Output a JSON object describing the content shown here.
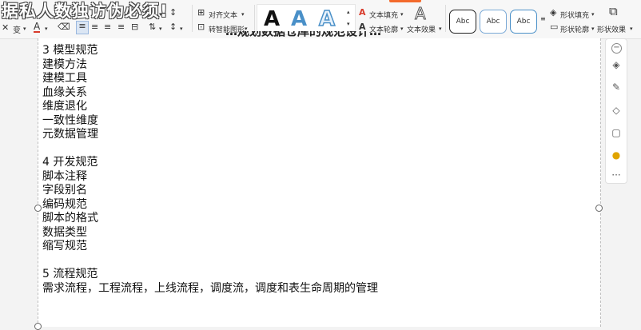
{
  "overlay": {
    "title": "据私人数独访伪必须!"
  },
  "ribbon": {
    "align_text_label": "对齐文本",
    "smart_shape_label": "转智能图形",
    "text_fill_label": "文本填充",
    "text_outline_label": "文本轮廓",
    "text_effect_label": "文本效果",
    "shape_fill_label": "形状填充",
    "shape_outline_label": "形状轮廓",
    "shape_effect_label": "形状效果",
    "font_size_glyph": "变",
    "style_letter": "A",
    "abc_styles": [
      "Abc",
      "Abc",
      "Abc"
    ],
    "colors": {
      "accent": "#f36a2c",
      "text_blue": "#4a90c8",
      "selection_blue": "#2d7ec9"
    }
  },
  "document": {
    "cut_title": "…规划数据仓库的规范设计…",
    "lines": [
      "3 模型规范",
      "建模方法",
      "建模工具",
      "血缘关系",
      "维度退化",
      "一致性维度",
      "元数据管理",
      "",
      "4 开发规范",
      "脚本注释",
      "字段别名",
      "编码规范",
      "脚本的格式",
      "数据类型",
      "缩写规范",
      "",
      "5 流程规范",
      "需求流程，工程流程，上线流程，调度流，调度和表生命周期的管理"
    ]
  },
  "side_panel": {
    "more_glyph": "···"
  }
}
